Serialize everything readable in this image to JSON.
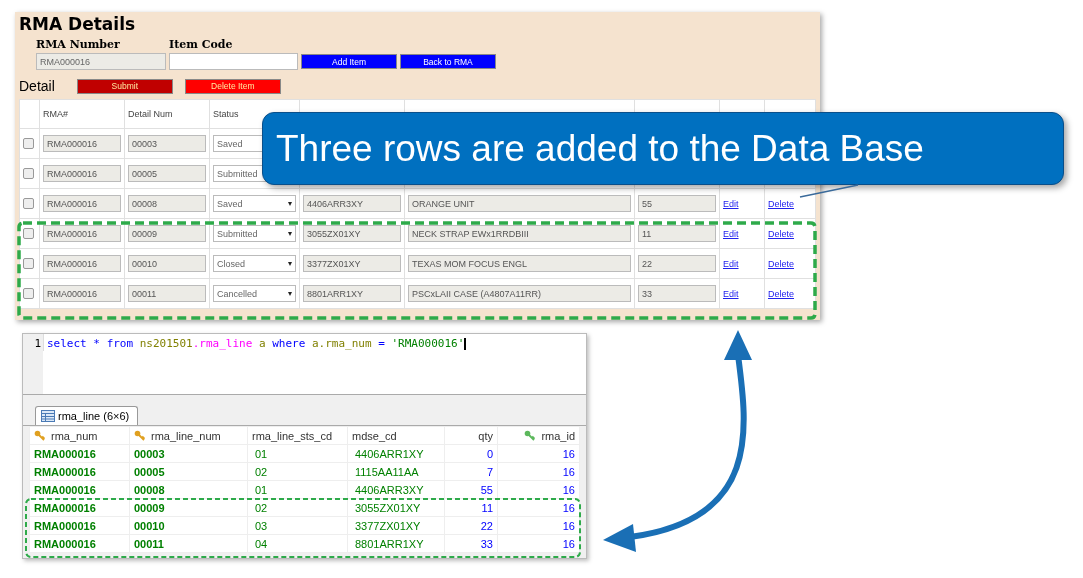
{
  "form": {
    "title": "RMA Details",
    "rma_number": {
      "label": "RMA Number",
      "value": "RMA000016"
    },
    "item_code": {
      "label": "Item Code"
    },
    "buttons": [
      "Add Item",
      "Back to RMA"
    ],
    "detail_label": "Detail",
    "detail_buttons": [
      {
        "label": "Submit",
        "kind": "submit"
      },
      {
        "label": "Delete Item",
        "kind": "delete"
      }
    ]
  },
  "detail_table": {
    "columns": [
      "RMA#",
      "Detail Num",
      "Status"
    ],
    "rows": [
      {
        "checked": false,
        "rma": "RMA000016",
        "detail_num": "00003",
        "status": "Saved"
      },
      {
        "checked": false,
        "rma": "RMA000016",
        "detail_num": "00005",
        "status": "Submitted"
      },
      {
        "checked": false,
        "rma": "RMA000016",
        "detail_num": "00008",
        "status": "Saved",
        "item_code": "4406ARR3XY",
        "description": "ORANGE UNIT",
        "qty": "55",
        "edit": "Edit",
        "delete": "Delete"
      },
      {
        "checked": false,
        "rma": "RMA000016",
        "detail_num": "00009",
        "status": "Submitted",
        "item_code": "3055ZX01XY",
        "description": "NECK STRAP EWx1RRDBIII",
        "qty": "11",
        "edit": "Edit",
        "delete": "Delete"
      },
      {
        "checked": false,
        "rma": "RMA000016",
        "detail_num": "00010",
        "status": "Closed",
        "item_code": "3377ZX01XY",
        "description": "TEXAS MOM FOCUS ENGL",
        "qty": "22",
        "edit": "Edit",
        "delete": "Delete"
      },
      {
        "checked": false,
        "rma": "RMA000016",
        "detail_num": "00011",
        "status": "Cancelled",
        "item_code": "8801ARR1XY",
        "description": "PSCxLAII CASE (A4807A11RR)",
        "qty": "33",
        "edit": "Edit",
        "delete": "Delete"
      }
    ]
  },
  "callout": {
    "text": "Three rows are added to the Data Base"
  },
  "sql_editor": {
    "line_number": "1",
    "tokens": [
      {
        "text": "select",
        "kind": "keyword"
      },
      {
        "text": " * ",
        "kind": "operator"
      },
      {
        "text": "from",
        "kind": "keyword"
      },
      {
        "text": " ns201501",
        "kind": "identifier"
      },
      {
        "text": ".",
        "kind": "table"
      },
      {
        "text": "rma_line",
        "kind": "table"
      },
      {
        "text": " a ",
        "kind": "identifier"
      },
      {
        "text": "where",
        "kind": "keyword"
      },
      {
        "text": " a.rma_num",
        "kind": "identifier"
      },
      {
        "text": " = ",
        "kind": "operator"
      },
      {
        "text": "'RMA000016'",
        "kind": "string"
      }
    ]
  },
  "result_tab": {
    "label": "rma_line (6×6)",
    "selected": true
  },
  "result_grid": {
    "columns": [
      {
        "label": "rma_num",
        "kind": "key_bold"
      },
      {
        "label": "rma_line_num",
        "kind": "key_bold"
      },
      {
        "label": "rma_line_sts_cd",
        "kind": "text"
      },
      {
        "label": "mdse_cd",
        "kind": "text"
      },
      {
        "label": "qty",
        "kind": "number"
      },
      {
        "label": "rma_id",
        "kind": "key_number"
      }
    ],
    "rows": [
      [
        "RMA000016",
        "00003",
        "01",
        "4406ARR1XY",
        "0",
        "16"
      ],
      [
        "RMA000016",
        "00005",
        "02",
        "1115AA11AA",
        "7",
        "16"
      ],
      [
        "RMA000016",
        "00008",
        "01",
        "4406ARR3XY",
        "55",
        "16"
      ],
      [
        "RMA000016",
        "00009",
        "02",
        "3055ZX01XY",
        "11",
        "16"
      ],
      [
        "RMA000016",
        "00010",
        "03",
        "3377ZX01XY",
        "22",
        "16"
      ],
      [
        "RMA000016",
        "00011",
        "04",
        "8801ARR1XY",
        "33",
        "16"
      ]
    ]
  }
}
